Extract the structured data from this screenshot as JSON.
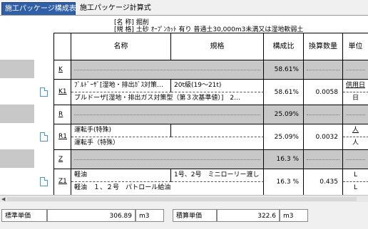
{
  "tabs": [
    {
      "label": "施工パッケージ構成表",
      "active": true
    },
    {
      "label": "施工パッケージ計算式",
      "active": false
    }
  ],
  "header": {
    "name_label": "[名 称]",
    "name_value": "掘削",
    "spec_label": "[規 格]",
    "spec_value": "土砂 ｵｰﾌﾟﾝｶｯﾄ 有り 普通土30,000m3未満又は湿地軟弱土"
  },
  "columns": {
    "name": "名称",
    "spec": "規格",
    "ratio": "構成比",
    "qty": "換算数量",
    "unit": "単位"
  },
  "rows": [
    {
      "code": "K",
      "kind": "group",
      "ratio": "58.61%"
    },
    {
      "code": "K1",
      "kind": "item",
      "name_short": "ﾌﾞﾙﾄﾞｰｻﾞ[湿地・排出ｶﾞｽ対策…",
      "spec_short": "20t級(19～21t)",
      "name_full": "ブルドーザ[湿地・排出ガス対策型（第３次基準値）]　2…",
      "ratio": "58.61%",
      "qty": "0.0058",
      "unit_top": "供用日",
      "unit_bottom": "日"
    },
    {
      "code": "R",
      "kind": "group",
      "ratio": "25.09%"
    },
    {
      "code": "R1",
      "kind": "item",
      "name_short": "運転手(特殊)",
      "spec_short": "",
      "name_full": "運転手（特殊）",
      "ratio": "25.09%",
      "qty": "0.0032",
      "unit_top": "人",
      "unit_bottom": "人"
    },
    {
      "code": "Z",
      "kind": "group",
      "ratio": "16.3 %"
    },
    {
      "code": "Z1",
      "kind": "item",
      "name_short": "軽油",
      "spec_short": "1号、2号　ミニローリー渡し",
      "name_full": "軽油　１、２号　パトロール給油",
      "ratio": "16.3 %",
      "qty": "0.435",
      "unit_top": "L",
      "unit_bottom": "L"
    }
  ],
  "footer": {
    "std_label": "標準単価",
    "std_value": "306.89",
    "std_unit": "m3",
    "calc_label": "積算単価",
    "calc_value": "322.6",
    "calc_unit": "m3"
  }
}
